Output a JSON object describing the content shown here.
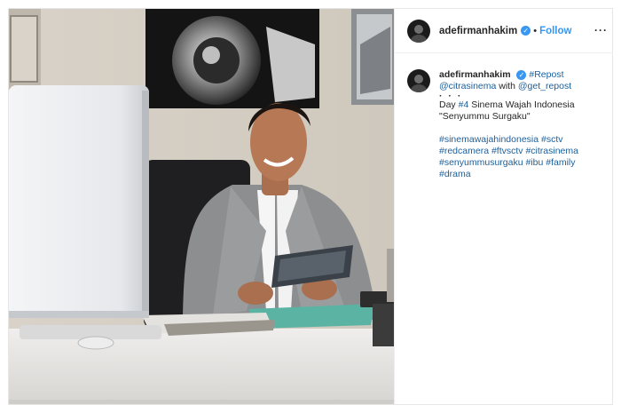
{
  "post": {
    "username": "adefirmanhakim",
    "verified_icon": "check-icon",
    "separator": "•",
    "follow_label": "Follow",
    "more_label": "···"
  },
  "caption": {
    "username": "adefirmanhakim",
    "repost_tag": "#Repost",
    "credit_handle": "@citrasinema",
    "credit_with": "with",
    "credit_tool": "@get_repost",
    "dots": "· · ·",
    "line_day": "Day",
    "day_tag": "#4",
    "day_rest": "Sinema Wajah Indonesia",
    "title": "\"Senyummu Surgaku\"",
    "hashtags_line1": "#sinemawajahindonesia #sctv",
    "hashtags_line2": "#redcamera #ftvsctv #citrasinema",
    "hashtags_line3": "#senyummusurgaku #ibu #family",
    "hashtags_line4": "#drama"
  },
  "colors": {
    "link": "#1b5f9b",
    "follow": "#3897f0",
    "verified": "#3897f0"
  }
}
